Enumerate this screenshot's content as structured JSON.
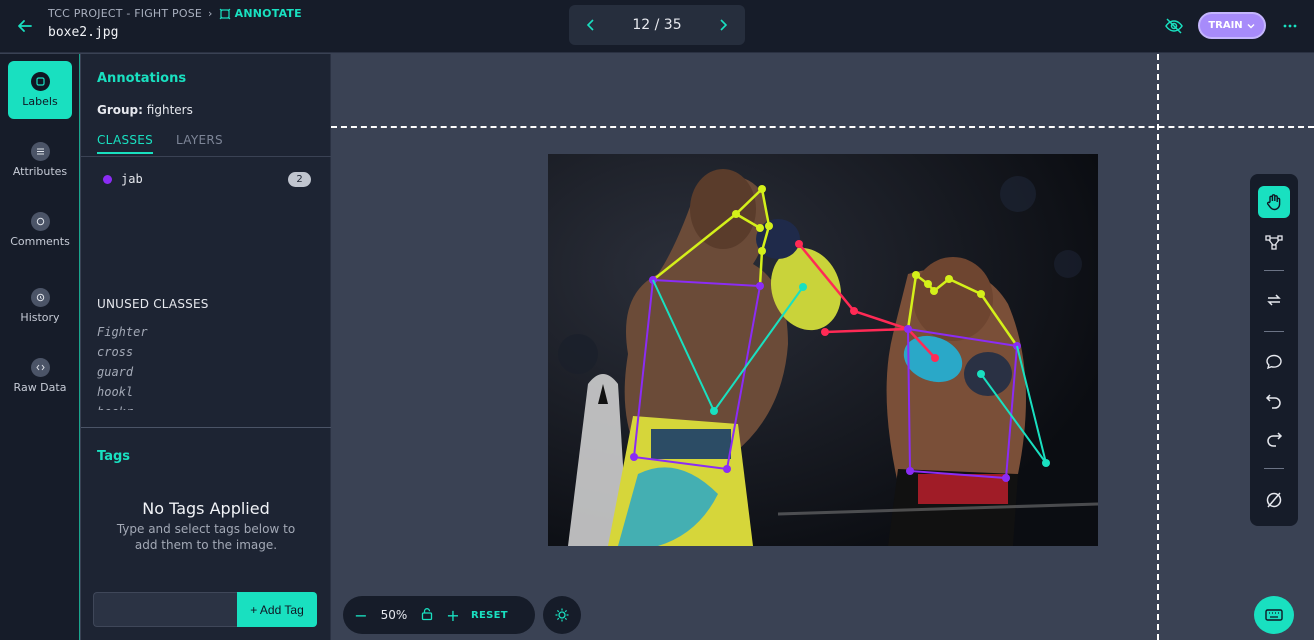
{
  "header": {
    "project": "TCC PROJECT - FIGHT POSE",
    "mode": "ANNOTATE",
    "filename": "boxe2.jpg",
    "pager": "12 / 35",
    "train_label": "TRAIN"
  },
  "rail": {
    "labels": "Labels",
    "attributes": "Attributes",
    "comments": "Comments",
    "history": "History",
    "raw": "Raw Data"
  },
  "panel": {
    "title": "Annotations",
    "group_label": "Group:",
    "group_value": "fighters",
    "tab_classes": "CLASSES",
    "tab_layers": "LAYERS",
    "classes": [
      {
        "name": "jab",
        "count": "2",
        "color": "#8b2cf5"
      }
    ],
    "unused_title": "UNUSED CLASSES",
    "unused": [
      "Fighter",
      "cross",
      "guard",
      "hookl",
      "hookr"
    ],
    "tags_title": "Tags",
    "tags_empty_title": "No Tags Applied",
    "tags_empty_sub": "Type and select tags below to add them to the image.",
    "add_tag": "+ Add Tag"
  },
  "zoom": {
    "value": "50%",
    "reset": "RESET"
  },
  "colors": {
    "accent": "#19e0c0",
    "purple": "#8b2cf5",
    "yellow": "#d4f01a",
    "red": "#ff2a55",
    "cyan": "#19e0c0"
  }
}
